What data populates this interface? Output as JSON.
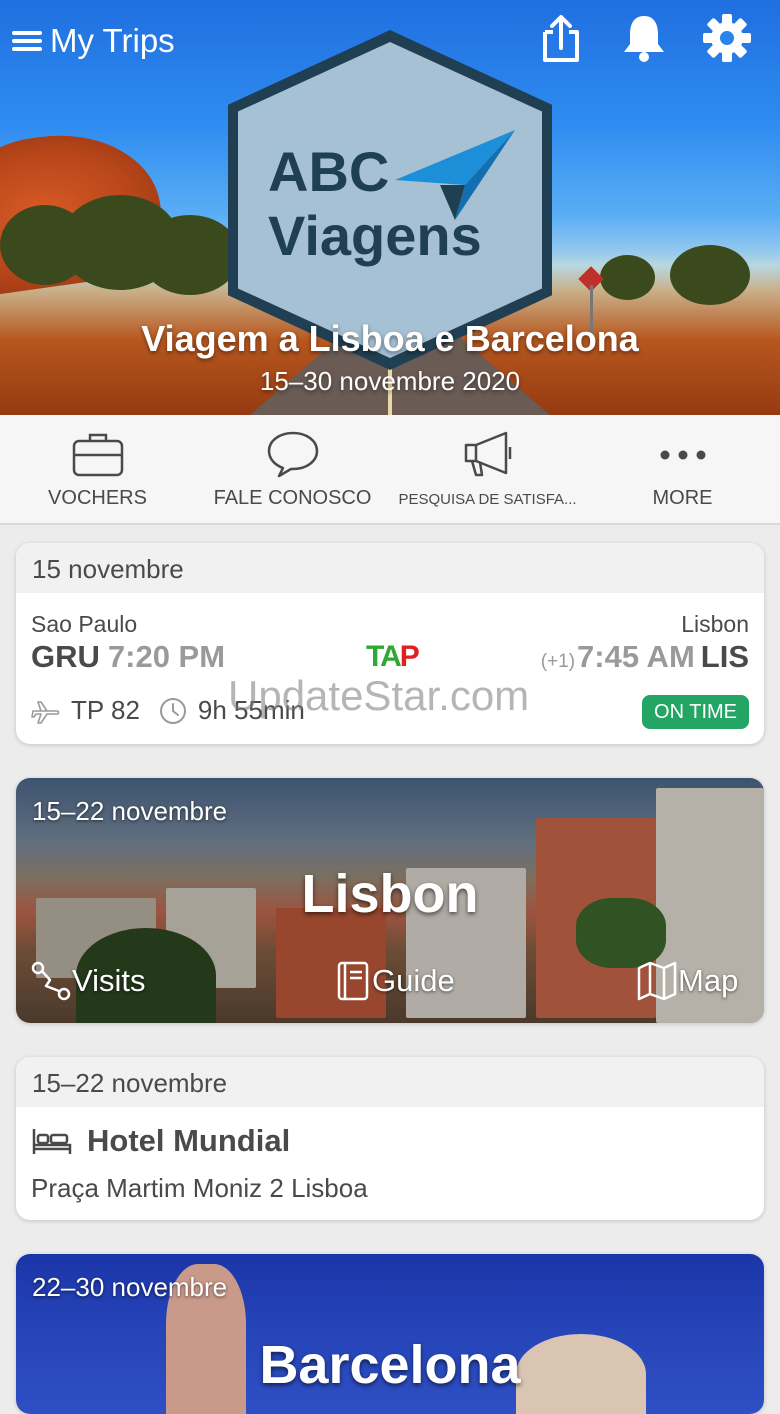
{
  "header": {
    "menu_title": "My Trips",
    "icons": [
      "share-icon",
      "bell-icon",
      "gear-icon"
    ]
  },
  "hero": {
    "logo_line1": "ABC",
    "logo_line2": "Viagens",
    "trip_title": "Viagem a Lisboa e Barcelona",
    "trip_dates": "15–30 novembre 2020"
  },
  "actions": [
    {
      "label": "VOCHERS",
      "icon": "briefcase-icon"
    },
    {
      "label": "FALE CONOSCO",
      "icon": "chat-bubble-icon"
    },
    {
      "label": "PESQUISA DE SATISFA...",
      "icon": "megaphone-icon"
    },
    {
      "label": "MORE",
      "icon": "more-dots-icon"
    }
  ],
  "flight": {
    "date": "15 novembre",
    "from_city": "Sao Paulo",
    "from_code": "GRU",
    "dep_time": "7:20 PM",
    "airline_logo_a": "TA",
    "airline_logo_b": "P",
    "to_city": "Lisbon",
    "arr_offset": "(+1)",
    "arr_time": "7:45 AM",
    "to_code": "LIS",
    "flight_number": "TP 82",
    "duration": "9h 55min",
    "status": "ON TIME"
  },
  "watermark": "UpdateStar.com",
  "lisbon": {
    "date": "15–22 novembre",
    "name": "Lisbon",
    "links": {
      "visits": "Visits",
      "guide": "Guide",
      "map": "Map"
    }
  },
  "hotel": {
    "date": "15–22 novembre",
    "name": "Hotel Mundial",
    "address": "Praça Martim Moniz 2 Lisboa"
  },
  "barcelona": {
    "date": "22–30 novembre",
    "name": "Barcelona"
  },
  "colors": {
    "status_green": "#23a664",
    "text_dark": "#4a4a4a",
    "text_muted": "#9a9a9a",
    "tap_green": "#2fa834",
    "tap_red": "#e02020"
  }
}
